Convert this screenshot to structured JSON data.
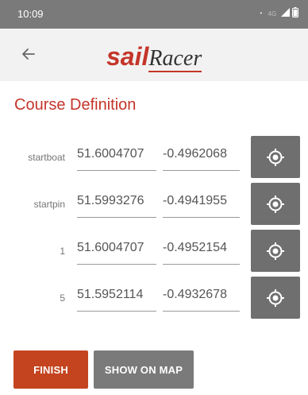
{
  "status_bar": {
    "time": "10:09",
    "network": "4G",
    "dot": "•"
  },
  "app_bar": {
    "logo_part1": "sail",
    "logo_part2": "Racer"
  },
  "page": {
    "title": "Course Definition"
  },
  "marks": [
    {
      "label": "startboat",
      "lat": "51.6004707",
      "lon": "-0.4962068"
    },
    {
      "label": "startpin",
      "lat": "51.5993276",
      "lon": "-0.4941955"
    },
    {
      "label": "1",
      "lat": "51.6004707",
      "lon": "-0.4952154"
    },
    {
      "label": "5",
      "lat": "51.5952114",
      "lon": "-0.4932678"
    }
  ],
  "actions": {
    "finish_label": "FINISH",
    "show_map_label": "SHOW ON MAP"
  },
  "colors": {
    "accent": "#c4352a",
    "finish_button": "#c4441f",
    "secondary_button": "#7a7a7a",
    "status_bar": "#7a7a7a",
    "app_bar": "#f2f2f2"
  },
  "icons": {
    "back": "arrow-left-icon",
    "gps": "gps-fixed-icon"
  }
}
